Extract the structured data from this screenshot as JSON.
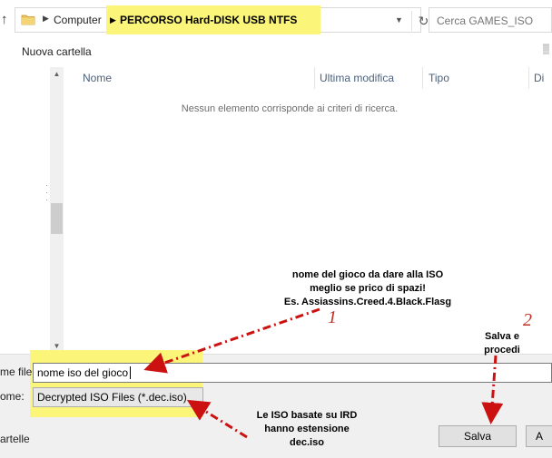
{
  "address_bar": {
    "computer_label": "Computer",
    "path_highlight": "PERCORSO Hard-DISK USB NTFS"
  },
  "search": {
    "placeholder": "Cerca GAMES_ISO"
  },
  "toolbar": {
    "new_folder_label": "Nuova cartella"
  },
  "file_list": {
    "columns": [
      "Nome",
      "Ultima modifica",
      "Tipo",
      "Di"
    ],
    "empty_message": "Nessun elemento corrisponde ai criteri di ricerca."
  },
  "annotations": {
    "note_1": {
      "line1": "nome del gioco da dare alla ISO",
      "line2": "meglio se prico di spazi!",
      "line3": "Es. Assiassins.Creed.4.Black.Flasg",
      "number": "1"
    },
    "note_2": {
      "line1": "Salva e",
      "line2": "procedi",
      "number": "2"
    },
    "note_3": {
      "line1": "Le ISO basate su IRD",
      "line2": "hanno estensione",
      "line3": "dec.iso"
    },
    "arrow_color": "#cc1111"
  },
  "bottom": {
    "filename_label": "me file:",
    "filename_value": "nome iso del gioco",
    "type_label": "ome:",
    "type_value": "Decrypted ISO Files (*.dec.iso)",
    "hide_folders_label": "artelle",
    "save_label": "Salva",
    "cancel_label": "A"
  },
  "colors": {
    "highlight": "#fbf57a",
    "header_text": "#4c607a"
  }
}
